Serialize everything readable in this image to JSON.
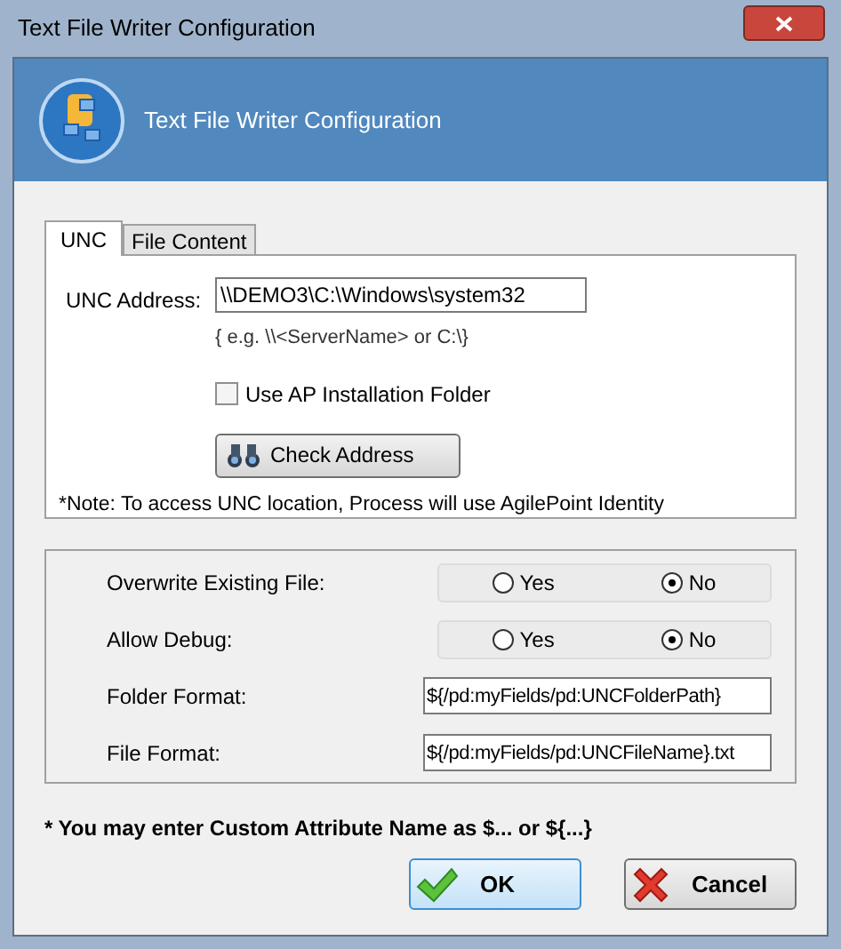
{
  "window": {
    "title": "Text File Writer Configuration"
  },
  "header": {
    "title": "Text File Writer Configuration"
  },
  "tabs": [
    {
      "label": "UNC",
      "selected": true
    },
    {
      "label": "File Content",
      "selected": false
    }
  ],
  "unc": {
    "label": "UNC Address:",
    "value": "\\\\DEMO3\\C:\\Windows\\system32",
    "hint": "{ e.g. \\\\<ServerName> or C:\\}",
    "checkbox": {
      "label": "Use AP Installation Folder",
      "checked": false
    },
    "check_button": "Check Address",
    "note": "*Note: To access UNC location, Process will use AgilePoint Identity"
  },
  "options": [
    {
      "kind": "radio",
      "label": "Overwrite Existing File:",
      "choices": [
        {
          "label": "Yes",
          "selected": false
        },
        {
          "label": "No",
          "selected": true
        }
      ]
    },
    {
      "kind": "radio",
      "label": "Allow Debug:",
      "choices": [
        {
          "label": "Yes",
          "selected": false
        },
        {
          "label": "No",
          "selected": true
        }
      ]
    },
    {
      "kind": "text",
      "label": "Folder Format:",
      "value": "${/pd:myFields/pd:UNCFolderPath}"
    },
    {
      "kind": "text",
      "label": "File Format:",
      "value": "${/pd:myFields/pd:UNCFileName}.txt"
    }
  ],
  "footnote": "* You may enter Custom Attribute Name as $... or ${...}",
  "buttons": [
    {
      "kind": "ok",
      "label": "OK"
    },
    {
      "kind": "cancel",
      "label": "Cancel"
    }
  ]
}
